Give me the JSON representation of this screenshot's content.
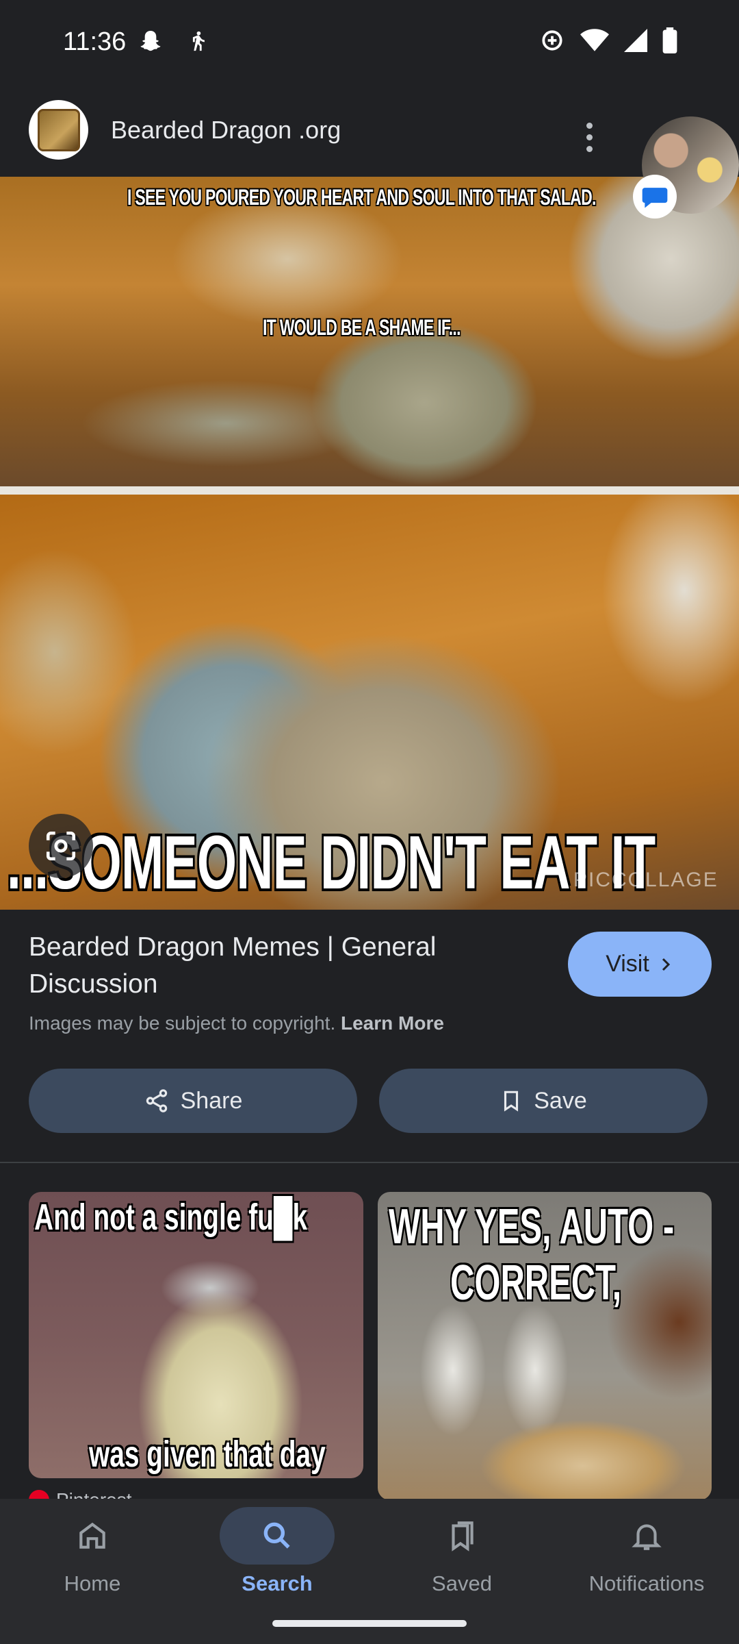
{
  "status_bar": {
    "time": "11:36",
    "left_icons": [
      "snapchat-icon",
      "walking-icon"
    ],
    "right_icons": [
      "data-saver-icon",
      "wifi-icon",
      "signal-icon",
      "battery-icon"
    ]
  },
  "header": {
    "site_name": "Bearded Dragon .org",
    "logo_icon": "bearded-dragon-org-logo",
    "more_icon": "more-vert-icon"
  },
  "chat_head": {
    "avatar": "chat-head-avatar",
    "badge_icon": "messages-icon"
  },
  "main_image": {
    "caption_top": "I SEE YOU POURED YOUR HEART AND SOUL INTO THAT SALAD.",
    "caption_middle": "IT WOULD BE A SHAME IF...",
    "caption_bottom": "...SOMEONE DIDN'T EAT IT",
    "watermark": "PICCOLLAGE",
    "lens_icon": "google-lens-icon"
  },
  "result": {
    "title": "Bearded Dragon Memes | General Discussion",
    "visit_label": "Visit",
    "copyright_text": "Images may be subject to copyright.",
    "learn_more": "Learn More"
  },
  "actions": {
    "share_label": "Share",
    "save_label": "Save"
  },
  "related": [
    {
      "line1": "And not a single fu█k",
      "line2": "was given that day",
      "source": "Pinterest"
    },
    {
      "line1": "WHY YES, AUTO -",
      "line2": "CORRECT,"
    }
  ],
  "bottom_nav": {
    "items": [
      {
        "label": "Home",
        "icon": "home-icon",
        "active": false
      },
      {
        "label": "Search",
        "icon": "search-icon",
        "active": true
      },
      {
        "label": "Saved",
        "icon": "saved-collections-icon",
        "active": false
      },
      {
        "label": "Notifications",
        "icon": "bell-icon",
        "active": false
      }
    ]
  },
  "colors": {
    "background": "#202124",
    "accent": "#8ab4f8",
    "button_bg": "#3c4a5e",
    "nav_active_pill": "#394457"
  }
}
